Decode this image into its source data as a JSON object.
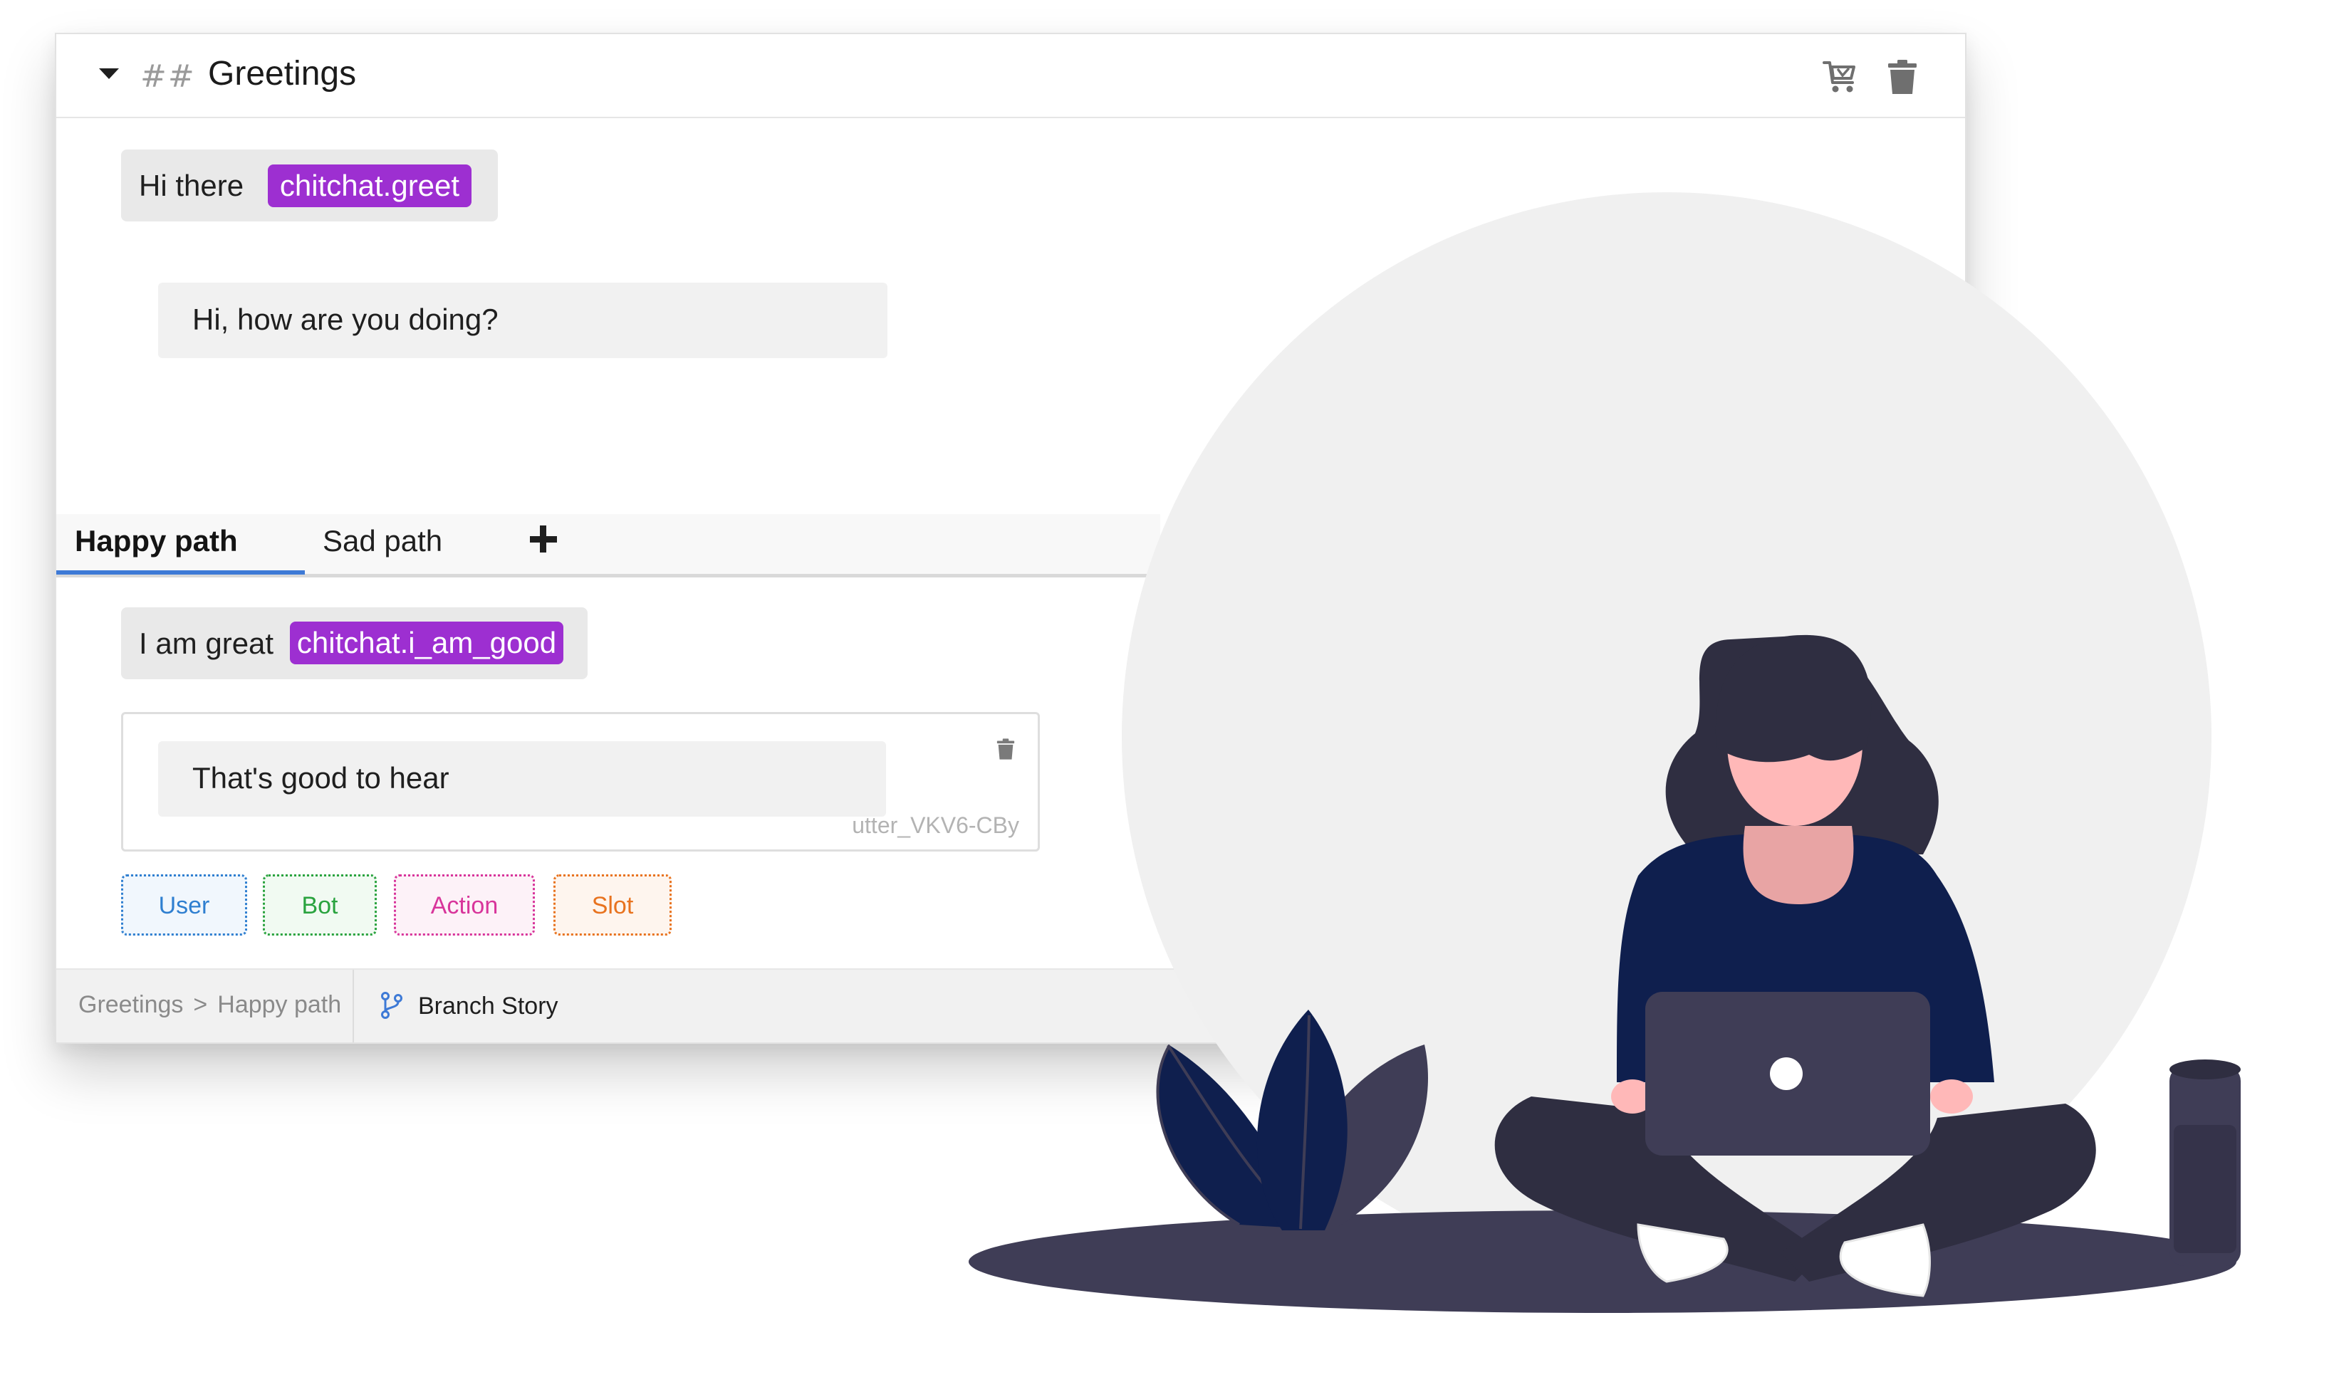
{
  "story": {
    "collapse_icon": "caret-down-icon",
    "hash_marker": "##",
    "title": "Greetings",
    "header_actions": [
      {
        "icon": "cart-icon"
      },
      {
        "icon": "trash-icon"
      }
    ]
  },
  "intro": {
    "user_text": "Hi there",
    "intent": "chitchat.greet",
    "bot_text": "Hi, how are you doing?"
  },
  "branches": {
    "tabs": [
      {
        "label": "Happy path",
        "active": true
      },
      {
        "label": "Sad path",
        "active": false
      }
    ],
    "add_icon": "plus-icon"
  },
  "branch_content": {
    "user_text": "I am great",
    "intent": "chitchat.i_am_good",
    "bot_text": "That's good to hear",
    "utter_id": "utter_VKV6-CBy",
    "delete_icon": "trash-icon"
  },
  "add_buttons": [
    {
      "label": "User",
      "color": "#2f7fd0"
    },
    {
      "label": "Bot",
      "color": "#2aa33f"
    },
    {
      "label": "Action",
      "color": "#d8359b"
    },
    {
      "label": "Slot",
      "color": "#e8731f"
    }
  ],
  "footer": {
    "breadcrumb": [
      "Greetings",
      ">",
      "Happy path"
    ],
    "branch_label": "Branch Story",
    "branch_icon": "git-branch-icon"
  },
  "colors": {
    "intent_bg": "#9d2fd1",
    "tab_underline": "#3e7ad6",
    "illustration_navy": "#0f1f4e",
    "illustration_dark": "#3f3d56",
    "circle_bg": "#f0f0f0"
  }
}
